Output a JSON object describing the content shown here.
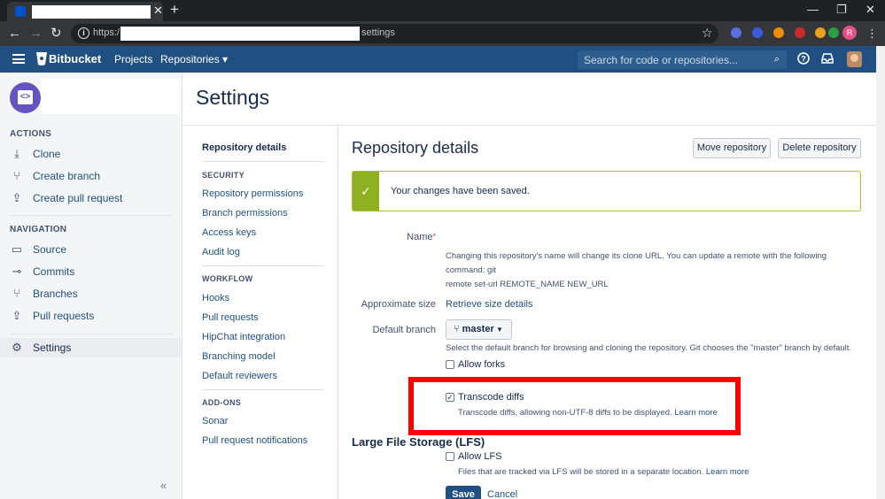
{
  "browser": {
    "address_prefix": "https:/",
    "address_suffix": "settings",
    "tab_close": "✕",
    "new_tab": "+",
    "extensions": [
      {
        "name": "extension-1",
        "color": "#5b6ee1"
      },
      {
        "name": "extension-2",
        "color": "#3b5bdb"
      },
      {
        "name": "extension-3",
        "color": "#f08c00"
      },
      {
        "name": "extension-4",
        "color": "#c92a2a"
      },
      {
        "name": "extension-5",
        "color": "#e8a317"
      },
      {
        "name": "extension-6",
        "color": "#2f9e44"
      }
    ],
    "profile_initial": "R"
  },
  "header": {
    "brand": "Bitbucket",
    "nav": [
      "Projects",
      "Repositories ▾"
    ],
    "search_placeholder": "Search for code or repositories...",
    "brand_color": "#205081"
  },
  "sidebar": {
    "actions_heading": "ACTIONS",
    "actions": [
      {
        "label": "Clone",
        "icon": "download-icon"
      },
      {
        "label": "Create branch",
        "icon": "branch-create-icon"
      },
      {
        "label": "Create pull request",
        "icon": "pull-request-create-icon"
      }
    ],
    "navigation_heading": "NAVIGATION",
    "navigation": [
      {
        "label": "Source",
        "icon": "source-icon"
      },
      {
        "label": "Commits",
        "icon": "commit-icon"
      },
      {
        "label": "Branches",
        "icon": "branch-icon"
      },
      {
        "label": "Pull requests",
        "icon": "pull-request-icon"
      }
    ],
    "settings_label": "Settings",
    "collapse": "«"
  },
  "page": {
    "title": "Settings"
  },
  "settings_nav": {
    "active": "Repository details",
    "sections": [
      {
        "heading": "SECURITY",
        "links": [
          "Repository permissions",
          "Branch permissions",
          "Access keys",
          "Audit log"
        ]
      },
      {
        "heading": "WORKFLOW",
        "links": [
          "Hooks",
          "Pull requests",
          "HipChat integration",
          "Branching model",
          "Default reviewers"
        ]
      },
      {
        "heading": "ADD-ONS",
        "links": [
          "Sonar",
          "Pull request notifications"
        ]
      }
    ]
  },
  "content": {
    "title": "Repository details",
    "move_button": "Move repository",
    "delete_button": "Delete repository",
    "success_message": "Your changes have been saved.",
    "name_label": "Name",
    "name_required": "*",
    "name_desc_1": "Changing this repository's name will change its clone URL. You can update a remote with the following command: git",
    "name_desc_2": "remote set-url REMOTE_NAME NEW_URL",
    "size_label": "Approximate size",
    "size_link": "Retrieve size details",
    "branch_label": "Default branch",
    "branch_value": "master",
    "branch_desc": "Select the default branch for browsing and cloning the repository. Git chooses the \"master\" branch by default.",
    "forks_label": "Allow forks",
    "transcode_label": "Transcode diffs",
    "transcode_desc": "Transcode diffs, allowing non-UTF-8 diffs to be displayed.",
    "learn_more": "Learn more",
    "lfs_title": "Large File Storage (LFS)",
    "lfs_label": "Allow LFS",
    "lfs_desc": "Files that are tracked via LFS will be stored in a separate location.",
    "save_button": "Save",
    "cancel_link": "Cancel",
    "highlight_color": "#ff0000"
  }
}
